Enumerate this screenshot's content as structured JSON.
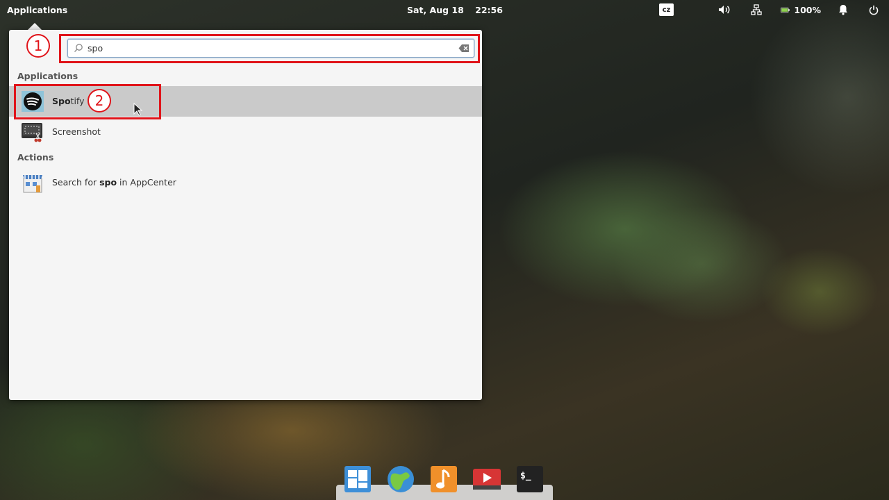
{
  "panel": {
    "applications_label": "Applications",
    "date": "Sat, Aug 18",
    "time": "22:56",
    "keyboard_layout": "cz",
    "battery_percent": "100%"
  },
  "launcher": {
    "search": {
      "value": "spo",
      "placeholder": ""
    },
    "sections": {
      "applications": "Applications",
      "actions": "Actions"
    },
    "results": [
      {
        "match": "Spo",
        "rest": "tify",
        "icon": "spotify-icon",
        "selected": true
      },
      {
        "label": "Screenshot",
        "icon": "screenshot-icon",
        "selected": false
      }
    ],
    "action": {
      "prefix": "Search for ",
      "query": "spo",
      "suffix": " in AppCenter",
      "icon": "appcenter-icon"
    }
  },
  "annotations": [
    "1",
    "2"
  ],
  "dock": [
    "multitasking-view-icon",
    "web-browser-icon",
    "music-icon",
    "videos-icon",
    "terminal-icon"
  ],
  "colors": {
    "annotation_red": "#e0141a",
    "selection": "#cacaca",
    "launcher_bg": "#f5f5f5"
  }
}
